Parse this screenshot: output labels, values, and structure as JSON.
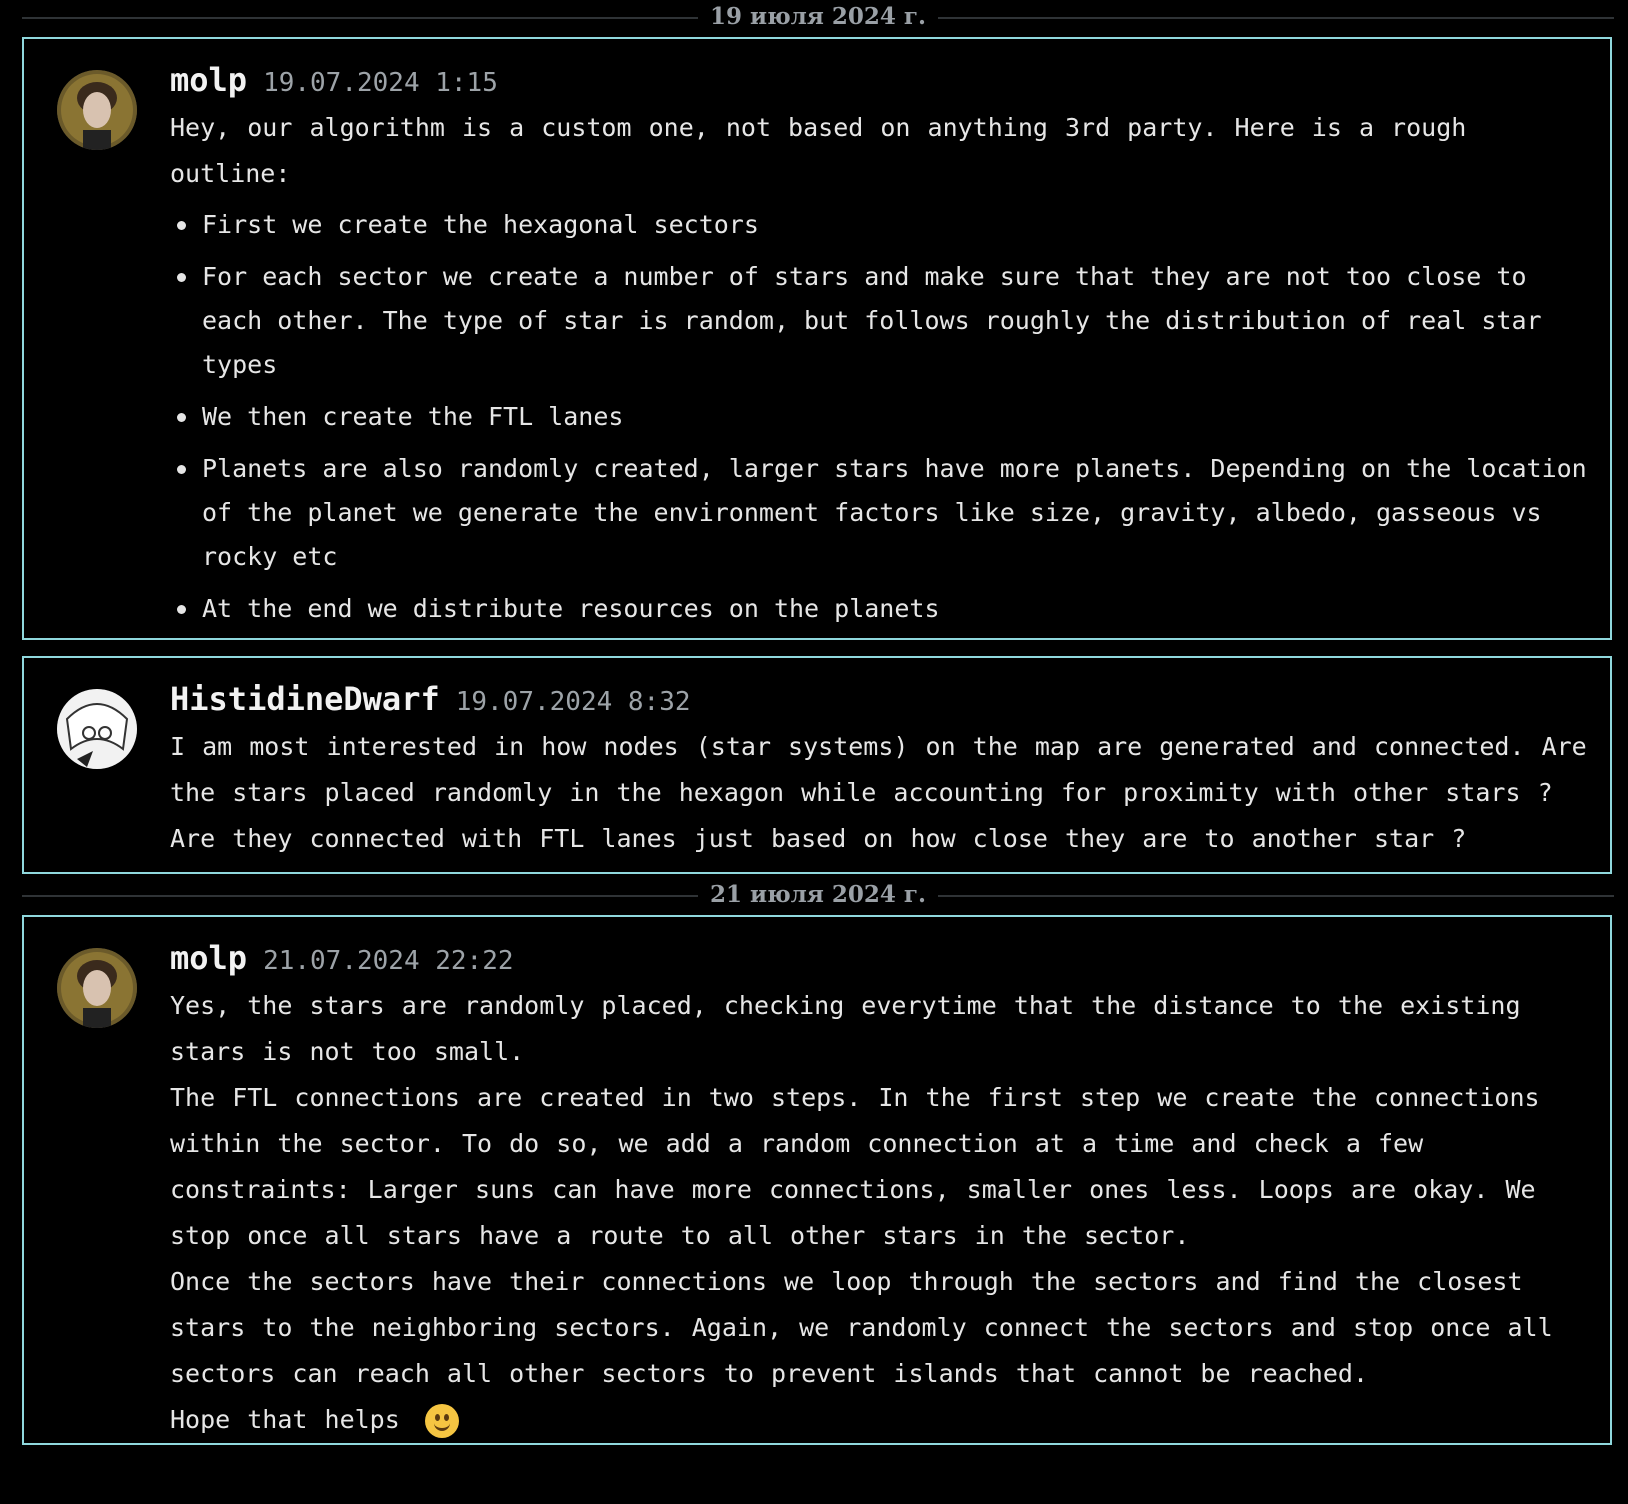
{
  "dates": [
    "19 июля 2024 г.",
    "21 июля 2024 г."
  ],
  "messages": [
    {
      "author": "molp",
      "time": "19.07.2024 1:15",
      "paragraphs": [
        "Hey, our algorithm is a custom one, not based on anything 3rd party. Here is a rough outline:"
      ],
      "bullets": [
        "First we create the hexagonal sectors",
        "For each sector we create a number of stars and make sure that they are not too close to each other. The type of star is random, but follows roughly the distribution of real star types",
        "We then create the FTL lanes",
        "Planets are also randomly created, larger stars have more planets. Depending on the location of the planet we generate the environment factors like size, gravity, albedo, gasseous vs rocky etc",
        "At the end we distribute resources on the planets"
      ]
    },
    {
      "author": "HistidineDwarf",
      "time": "19.07.2024 8:32",
      "paragraphs": [
        "I am most interested in how nodes (star systems) on the map are generated and connected. Are the stars placed randomly in the hexagon while accounting for proximity with other stars ? Are they connected with FTL lanes just based on how close they are to another star ?"
      ]
    },
    {
      "author": "molp",
      "time": "21.07.2024 22:22",
      "paragraphs": [
        "Yes, the stars are randomly placed, checking everytime that the distance to the existing stars is not too small.",
        "The FTL connections are created in two steps. In the first step we create the connections within the sector. To do so, we add a random connection at a time and check a few constraints: Larger suns can have more connections, smaller ones less. Loops are okay. We stop once all stars have a route to all other stars in the sector.",
        "Once the sectors have their connections we loop through the sectors and find the closest stars to the neighboring sectors. Again, we randomly connect the sectors and stop once all sectors can reach all other sectors to prevent islands that cannot be reached.",
        "Hope that helps"
      ],
      "emoji": "slightly-smiling-face"
    }
  ],
  "colors": {
    "border": "#8fd7dc",
    "background": "#000000",
    "text": "#e6e6e6",
    "muted": "#9da3a8"
  }
}
